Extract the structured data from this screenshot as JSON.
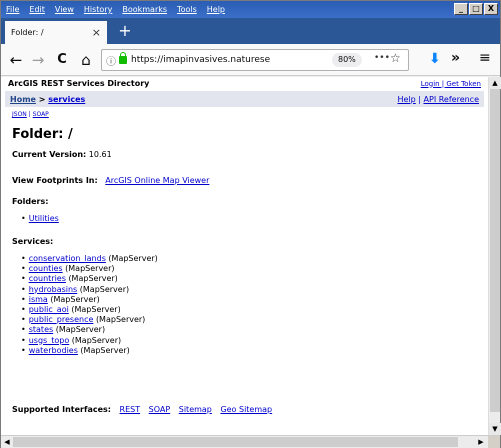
{
  "menu": [
    "File",
    "Edit",
    "View",
    "History",
    "Bookmarks",
    "Tools",
    "Help"
  ],
  "window_controls": {
    "minimize": "_",
    "maximize": "□",
    "close": "X"
  },
  "tab": {
    "title": "Folder: /",
    "close": "×",
    "new_tab": "+"
  },
  "nav": {
    "back": "←",
    "forward": "→",
    "reload": "C",
    "home": "⌂"
  },
  "url": {
    "info": "ⓘ",
    "text": "https://imapinvasives.naturese",
    "zoom": "80%",
    "more": "•••",
    "star": "☆"
  },
  "toolbar": {
    "download": "⬇",
    "overflow": "»",
    "menu": "≡"
  },
  "page": {
    "directory_title": "ArcGIS REST Services Directory",
    "login": "Login | Get Token",
    "breadcrumb_home": "Home",
    "breadcrumb_sep": " > ",
    "breadcrumb_services": "services",
    "help": "Help",
    "help_sep": " | ",
    "api_reference": "API Reference",
    "json": "JSON",
    "soap": "SOAP",
    "small_sep": " | ",
    "folder_heading": "Folder: /",
    "current_version_label": "Current Version:",
    "current_version_value": "10.61",
    "view_footprints_label": "View Footprints In:",
    "view_footprints_link": "ArcGIS Online Map Viewer",
    "folders_label": "Folders:",
    "folders": [
      "Utilities"
    ],
    "services_label": "Services:",
    "services": [
      {
        "name": "conservation_lands",
        "type": "(MapServer)"
      },
      {
        "name": "counties",
        "type": "(MapServer)"
      },
      {
        "name": "countries",
        "type": "(MapServer)"
      },
      {
        "name": "hydrobasins",
        "type": "(MapServer)"
      },
      {
        "name": "isma",
        "type": "(MapServer)"
      },
      {
        "name": "public_aoi",
        "type": "(MapServer)"
      },
      {
        "name": "public_presence",
        "type": "(MapServer)"
      },
      {
        "name": "states",
        "type": "(MapServer)"
      },
      {
        "name": "usgs_topo",
        "type": "(MapServer)"
      },
      {
        "name": "waterbodies",
        "type": "(MapServer)"
      }
    ],
    "supported_interfaces_label": "Supported Interfaces:",
    "interfaces": [
      "REST",
      "SOAP",
      "Sitemap",
      "Geo Sitemap"
    ]
  },
  "colors": {
    "titlebar": "#2a5db3",
    "tabstrip": "#2b5797",
    "link": "#0000cc",
    "breadcrumb_bg": "#e2e5ee"
  }
}
